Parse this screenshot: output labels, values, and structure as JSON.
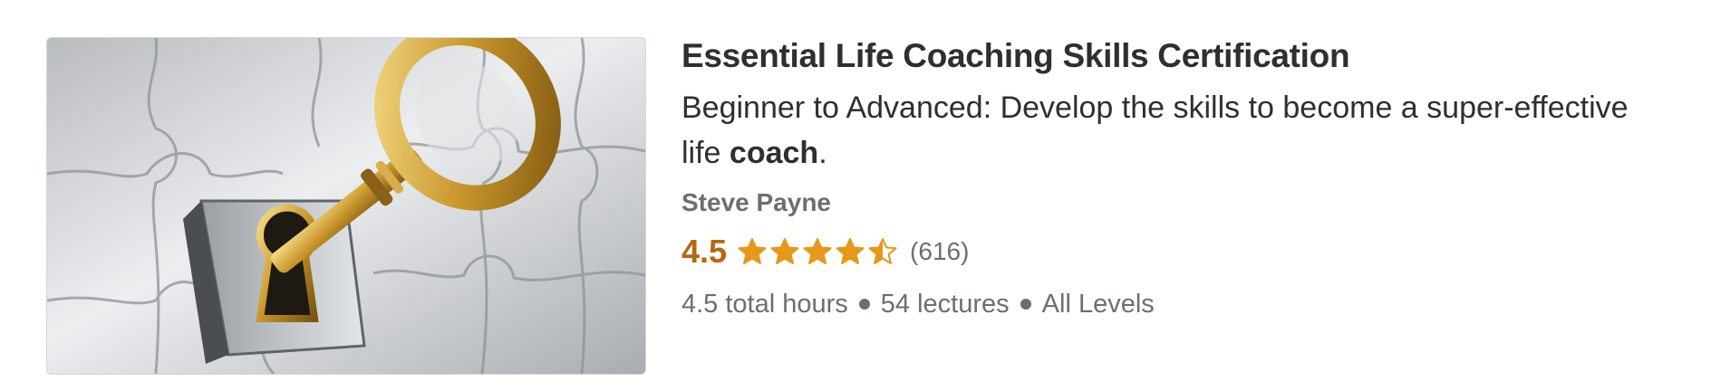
{
  "course": {
    "title": "Essential Life Coaching Skills Certification",
    "headline_pre": "Beginner to Advanced: Develop the skills to become a super-effective life ",
    "headline_bold": "coach",
    "headline_post": ".",
    "instructor": "Steve Payne",
    "rating": "4.5",
    "rating_value": 4.5,
    "rating_max": 5,
    "review_count": "(616)",
    "meta": {
      "hours": "4.5 total hours",
      "lectures": "54 lectures",
      "level": "All Levels"
    }
  },
  "thumbnail": {
    "icon": "key-in-puzzle-lock-image"
  },
  "colors": {
    "star": "#e59819",
    "rating": "#b4690e",
    "muted": "#6a6f73",
    "title": "#2d2f31"
  }
}
